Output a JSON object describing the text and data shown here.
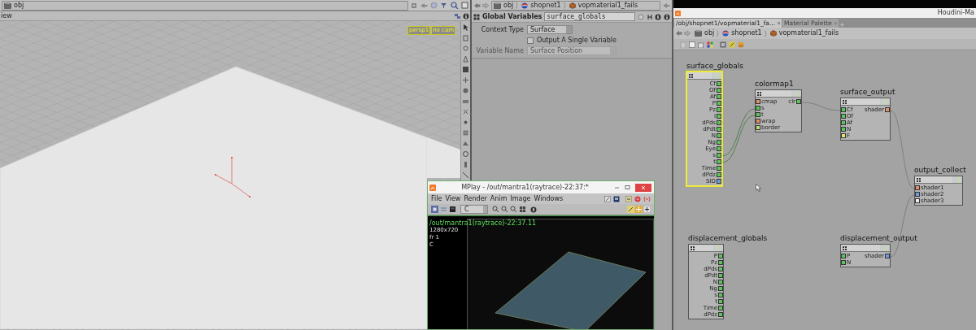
{
  "viewer": {
    "path": [
      {
        "label": "obj",
        "kind": "network"
      }
    ],
    "pane_title": "iew",
    "overlay_menus": [
      "persp1",
      "no cam"
    ]
  },
  "parameters": {
    "path": [
      {
        "label": "obj",
        "kind": "network"
      },
      {
        "label": "shopnet1",
        "kind": "ball"
      },
      {
        "label": "vopmaterial1_fails",
        "kind": "cube"
      }
    ],
    "node_type": "Global Variables",
    "node_name": "surface_globals",
    "rows": [
      {
        "kind": "dropdown",
        "label": "Context Type",
        "value": "Surface",
        "disabled": false
      },
      {
        "kind": "checkbox",
        "label": "Output A Single Variable",
        "checked": false
      },
      {
        "kind": "dropdown",
        "label": "Variable Name",
        "value": "Surface Position",
        "disabled": true
      }
    ]
  },
  "network": {
    "title": "Houdini-Ma",
    "tabs": [
      {
        "label": "/obj/shopnet1/vopmaterial1_fa...",
        "selected": true
      },
      {
        "label": "Material Palette",
        "selected": false
      }
    ],
    "path": [
      {
        "label": "obj",
        "kind": "network"
      },
      {
        "label": "shopnet1",
        "kind": "ball"
      },
      {
        "label": "vopmaterial1_fails",
        "kind": "cube"
      }
    ],
    "nodes": [
      {
        "name": "surface_globals",
        "selected": true,
        "outputs": [
          {
            "label": "Cf",
            "color": "#5cc45c"
          },
          {
            "label": "Of",
            "color": "#5cc45c"
          },
          {
            "label": "Af",
            "color": "#5cc45c"
          },
          {
            "label": "P",
            "color": "#5cc45c"
          },
          {
            "label": "Pz",
            "color": "#5cc45c"
          },
          {
            "label": "I",
            "color": "#5cc45c"
          },
          {
            "label": "dPds",
            "color": "#5cc45c"
          },
          {
            "label": "dPdt",
            "color": "#5cc45c"
          },
          {
            "label": "N",
            "color": "#5cc45c"
          },
          {
            "label": "Ng",
            "color": "#5cc45c"
          },
          {
            "label": "Eye",
            "color": "#5cc45c"
          },
          {
            "label": "s",
            "color": "#5cc45c"
          },
          {
            "label": "t",
            "color": "#5cc45c"
          },
          {
            "label": "Time",
            "color": "#5cc45c"
          },
          {
            "label": "dPdz",
            "color": "#5cc45c"
          },
          {
            "label": "SID",
            "color": "#6f9be0"
          }
        ]
      },
      {
        "name": "colormap1",
        "selected": false,
        "inputs": [
          {
            "label": "cmap",
            "color": "#e0906a"
          },
          {
            "label": "s",
            "color": "#5cc45c"
          },
          {
            "label": "t",
            "color": "#5cc45c"
          },
          {
            "label": "wrap",
            "color": "#e0906a"
          },
          {
            "label": "border",
            "color": "#b8e07a"
          }
        ],
        "outputs": [
          {
            "label": "clr",
            "color": "#5cc45c"
          }
        ]
      },
      {
        "name": "surface_output",
        "selected": false,
        "inputs": [
          {
            "label": "Cf",
            "color": "#5cc45c"
          },
          {
            "label": "Of",
            "color": "#5cc45c"
          },
          {
            "label": "Af",
            "color": "#5cc45c"
          },
          {
            "label": "N",
            "color": "#5cc45c"
          },
          {
            "label": "F",
            "color": "#e8e070"
          }
        ],
        "outputs": [
          {
            "label": "shader",
            "color": "#e0906a"
          }
        ]
      },
      {
        "name": "output_collect",
        "selected": false,
        "inputs": [
          {
            "label": "shader1",
            "color": "#e0906a"
          },
          {
            "label": "shader2",
            "color": "#6f9be0"
          },
          {
            "label": "shader3",
            "color": "#f0f0f0"
          }
        ]
      },
      {
        "name": "displacement_globals",
        "selected": false,
        "outputs": [
          {
            "label": "P",
            "color": "#5cc45c"
          },
          {
            "label": "Pz",
            "color": "#5cc45c"
          },
          {
            "label": "dPds",
            "color": "#5cc45c"
          },
          {
            "label": "dPdt",
            "color": "#5cc45c"
          },
          {
            "label": "N",
            "color": "#5cc45c"
          },
          {
            "label": "Ng",
            "color": "#5cc45c"
          },
          {
            "label": "s",
            "color": "#5cc45c"
          },
          {
            "label": "t",
            "color": "#5cc45c"
          },
          {
            "label": "Time",
            "color": "#5cc45c"
          },
          {
            "label": "dPdz",
            "color": "#5cc45c"
          }
        ]
      },
      {
        "name": "displacement_output",
        "selected": false,
        "inputs": [
          {
            "label": "P",
            "color": "#5cc45c"
          },
          {
            "label": "N",
            "color": "#5cc45c"
          }
        ],
        "outputs": [
          {
            "label": "shader",
            "color": "#6f9be0"
          }
        ]
      }
    ]
  },
  "mplay": {
    "title": "MPlay - /out/mantra1(raytrace)-22:37:*",
    "menus": [
      "File",
      "View",
      "Render",
      "Anim",
      "Image",
      "Windows"
    ],
    "channel": "C",
    "overlay": [
      "/out/mantra1(raytrace)-22:37.11",
      "1280x720",
      "fr 1",
      "C"
    ]
  }
}
